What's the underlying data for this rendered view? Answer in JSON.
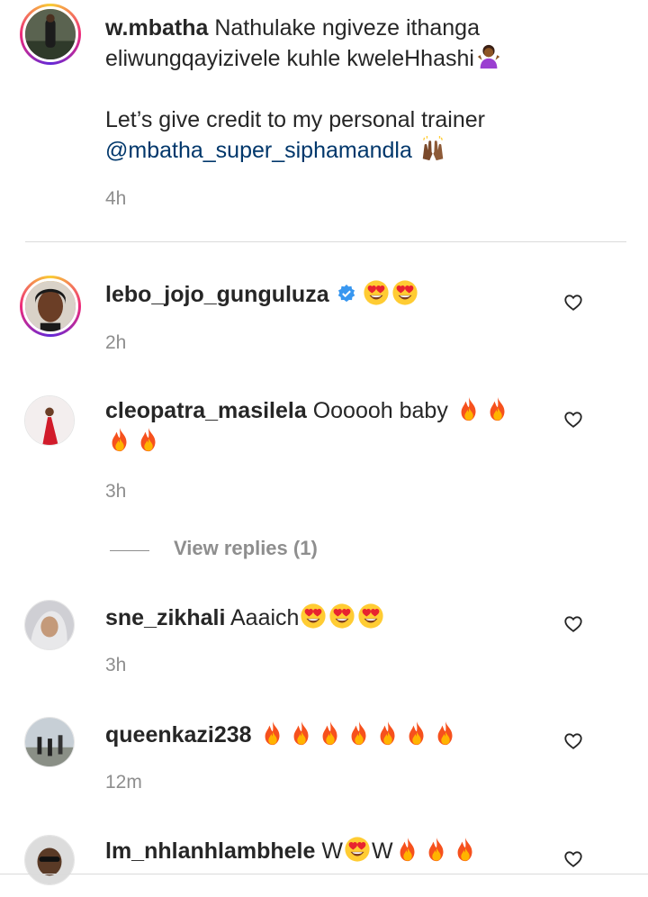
{
  "caption": {
    "username": "w.mbatha",
    "text_line1": "Nathulake ngiveze ithanga",
    "text_line2": "eliwungqayizivele kuhle kweleHhashi",
    "text_line3": "Let’s give credit to my personal trainer",
    "mention": "@mbatha_super_siphamandla",
    "time": "4h",
    "emojis": [
      "woman-shrugging-icon",
      "raising-hands-icon"
    ]
  },
  "comments": [
    {
      "username": "lebo_jojo_gunguluza",
      "verified": true,
      "text": "",
      "emojis": [
        "heart-eyes-icon",
        "heart-eyes-icon"
      ],
      "time": "2h"
    },
    {
      "username": "cleopatra_masilela",
      "text": "Oooooh baby",
      "emojis": [
        "fire-icon",
        "fire-icon",
        "fire-icon",
        "fire-icon"
      ],
      "time": "3h",
      "view_replies": "View replies (1)"
    },
    {
      "username": "sne_zikhali",
      "text": "Aaaich",
      "emojis": [
        "heart-eyes-icon",
        "heart-eyes-icon",
        "heart-eyes-icon"
      ],
      "time": "3h"
    },
    {
      "username": "queenkazi238",
      "text": "",
      "emojis": [
        "fire-icon",
        "fire-icon",
        "fire-icon",
        "fire-icon",
        "fire-icon",
        "fire-icon",
        "fire-icon"
      ],
      "time": "12m"
    },
    {
      "username": "lm_nhlanhlambhele",
      "text_pre": "W",
      "text_mid": "W",
      "emojis": [
        "heart-eyes-icon",
        "fire-icon",
        "fire-icon",
        "fire-icon"
      ],
      "time": ""
    }
  ],
  "colors": {
    "link": "#00376b",
    "meta": "#8e8e8e",
    "text": "#262626",
    "verified": "#3897f0"
  }
}
